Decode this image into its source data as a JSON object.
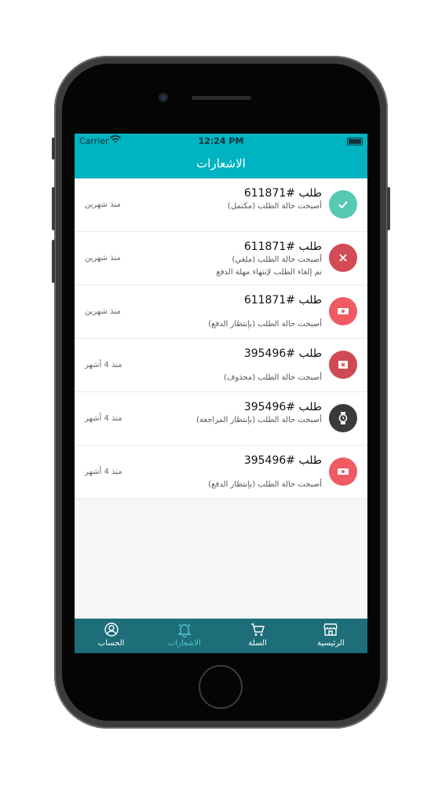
{
  "status_bar": {
    "carrier": "Carrier",
    "time": "12:24 PM"
  },
  "header": {
    "title": "الاشعارات"
  },
  "notifications": [
    {
      "title": "طلب #611871",
      "subtitle": "أصبحت حالة الطلب (مكتمل)",
      "detail": "",
      "time": "منذ شهرين",
      "icon": "check-icon",
      "color": "#55c9b4"
    },
    {
      "title": "طلب #611871",
      "subtitle": "أصبحت حالة الطلب (ملغي)",
      "detail": "تم إلغاء الطلب لإنتهاء مهلة الدفع",
      "time": "منذ شهرين",
      "icon": "close-icon",
      "color": "#d24b56"
    },
    {
      "title": "طلب #611871",
      "subtitle": "أصبحت حالة الطلب (بإنتظار الدفع)",
      "detail": "",
      "time": "منذ شهرين",
      "icon": "cash-icon",
      "color": "#ef5a63"
    },
    {
      "title": "طلب #395496",
      "subtitle": "أصبحت حالة الطلب (محذوف)",
      "detail": "",
      "time": "منذ 4 أشهر",
      "icon": "delete-box-icon",
      "color": "#cf4a55"
    },
    {
      "title": "طلب #395496",
      "subtitle": "أصبحت حالة الطلب (بإنتظار المراجعة)",
      "detail": "",
      "time": "منذ 4 أشهر",
      "icon": "watch-icon",
      "color": "#3a3a3a"
    },
    {
      "title": "طلب #395496",
      "subtitle": "أصبحت حالة الطلب (بإنتظار الدفع)",
      "detail": "",
      "time": "منذ 4 أشهر",
      "icon": "cash-icon",
      "color": "#ef5a63"
    }
  ],
  "tabbar": {
    "home": "الرئيسية",
    "cart": "السلة",
    "notifications": "الاشعارات",
    "account": "الحساب",
    "active_color": "#4fc9d3",
    "bar_color": "#1d6e78"
  }
}
